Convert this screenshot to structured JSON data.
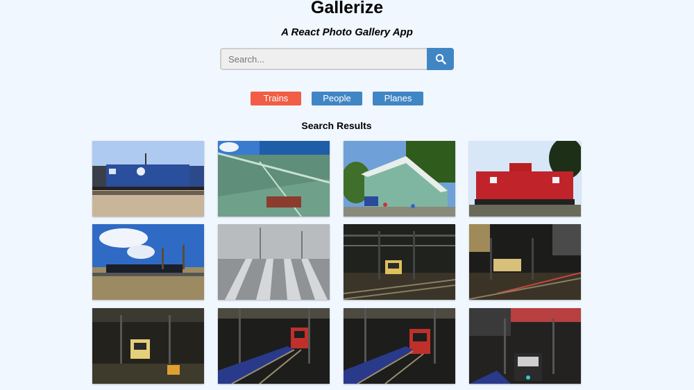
{
  "app": {
    "title": "Gallerize",
    "subtitle": "A React Photo Gallery App"
  },
  "search": {
    "placeholder": "Search...",
    "value": "",
    "button_icon": "search-icon"
  },
  "nav": {
    "items": [
      {
        "label": "Trains",
        "color": "#f15d45",
        "active": true
      },
      {
        "label": "People",
        "color": "#4186c4",
        "active": false
      },
      {
        "label": "Planes",
        "color": "#4186c4",
        "active": false
      }
    ]
  },
  "results": {
    "heading": "Search Results",
    "photos": [
      {
        "subject": "blue locomotive on rail line"
      },
      {
        "subject": "green train station roof"
      },
      {
        "subject": "green train station with crowd"
      },
      {
        "subject": "red caboose"
      },
      {
        "subject": "freight train under blue sky"
      },
      {
        "subject": "foggy rail yard"
      },
      {
        "subject": "commuter train under overhead wires"
      },
      {
        "subject": "commuter train in city rail yard"
      },
      {
        "subject": "commuter train in station"
      },
      {
        "subject": "red metro train on tracks"
      },
      {
        "subject": "red metro train on tracks"
      },
      {
        "subject": "metro train near buildings"
      }
    ]
  }
}
